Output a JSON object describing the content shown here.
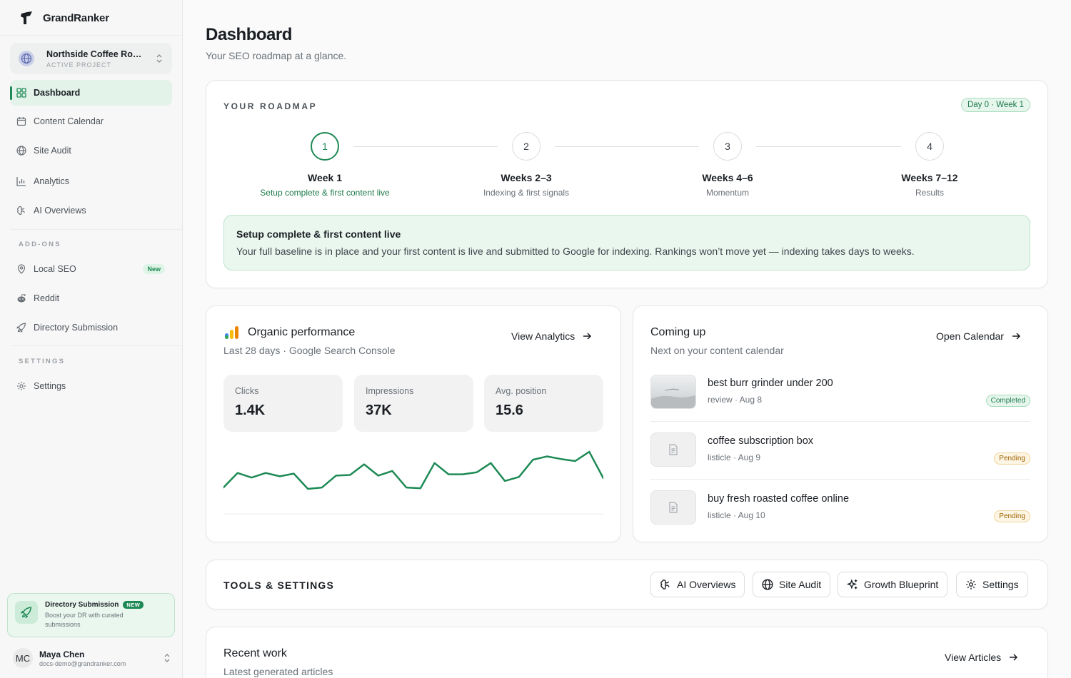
{
  "brand": {
    "name": "GrandRanker"
  },
  "project": {
    "name": "Northside Coffee Roa...",
    "label": "ACTIVE PROJECT"
  },
  "nav": {
    "dashboard": "Dashboard",
    "content_calendar": "Content Calendar",
    "site_audit": "Site Audit",
    "analytics": "Analytics",
    "ai_overviews": "AI Overviews"
  },
  "addons": {
    "label": "ADD-ONS",
    "local_seo": "Local SEO",
    "local_seo_badge": "New",
    "reddit": "Reddit",
    "directory_submission": "Directory Submission"
  },
  "settings_section": {
    "label": "SETTINGS",
    "settings": "Settings"
  },
  "promo": {
    "title": "Directory Submission",
    "badge": "NEW",
    "text": "Boost your DR with curated submissions"
  },
  "user": {
    "initials": "MC",
    "name": "Maya Chen",
    "email": "docs-demo@grandranker.com"
  },
  "page": {
    "title": "Dashboard",
    "subtitle": "Your SEO roadmap at a glance."
  },
  "roadmap": {
    "label": "YOUR ROADMAP",
    "pill": "Day 0 · Week 1",
    "steps": [
      {
        "num": "1",
        "title": "Week 1",
        "sub": "Setup complete & first content live"
      },
      {
        "num": "2",
        "title": "Weeks 2–3",
        "sub": "Indexing & first signals"
      },
      {
        "num": "3",
        "title": "Weeks 4–6",
        "sub": "Momentum"
      },
      {
        "num": "4",
        "title": "Weeks 7–12",
        "sub": "Results"
      }
    ],
    "callout_title": "Setup complete & first content live",
    "callout_text": "Your full baseline is in place and your first content is live and submitted to Google for indexing. Rankings won’t move yet — indexing takes days to weeks."
  },
  "performance": {
    "title": "Organic performance",
    "subtitle": "Last 28 days · Google Search Console",
    "link": "View Analytics",
    "stats": [
      {
        "label": "Clicks",
        "value": "1.4K"
      },
      {
        "label": "Impressions",
        "value": "37K"
      },
      {
        "label": "Avg. position",
        "value": "15.6"
      }
    ],
    "sparkline": [
      20,
      42,
      35,
      42,
      37,
      41,
      18,
      20,
      38,
      39,
      55,
      38,
      45,
      20,
      19,
      57,
      40,
      40,
      43,
      57,
      30,
      36,
      62,
      67,
      63,
      60,
      74,
      34
    ]
  },
  "coming_up": {
    "title": "Coming up",
    "subtitle": "Next on your content calendar",
    "link": "Open Calendar",
    "items": [
      {
        "title": "best burr grinder under 200",
        "meta": "review · Aug 8",
        "status": "Completed"
      },
      {
        "title": "coffee subscription box",
        "meta": "listicle · Aug 9",
        "status": "Pending"
      },
      {
        "title": "buy fresh roasted coffee online",
        "meta": "listicle · Aug 10",
        "status": "Pending"
      }
    ]
  },
  "tools": {
    "label": "TOOLS & SETTINGS",
    "buttons": [
      "AI Overviews",
      "Site Audit",
      "Growth Blueprint",
      "Settings"
    ]
  },
  "recent": {
    "title": "Recent work",
    "subtitle": "Latest generated articles",
    "link": "View Articles"
  },
  "colors": {
    "accent": "#1e8a55",
    "accent_soft": "#eaf7ef",
    "pending": "#a06400"
  }
}
